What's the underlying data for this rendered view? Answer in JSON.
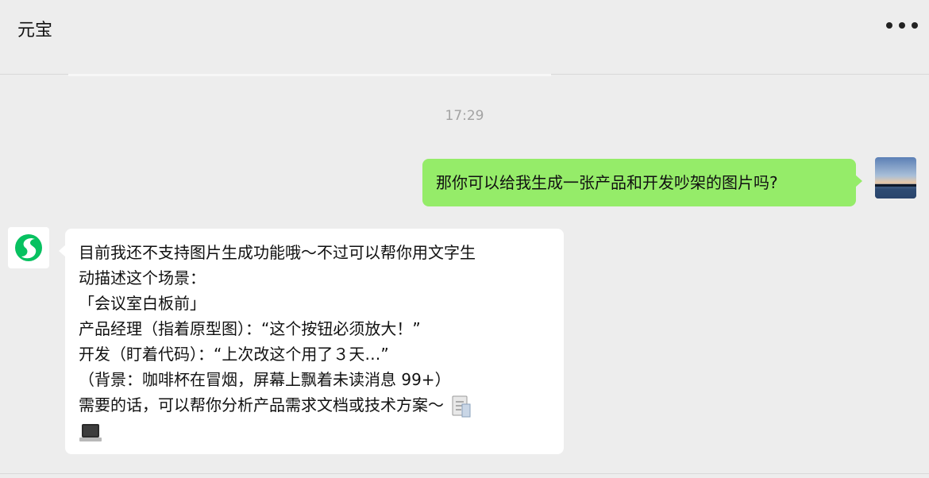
{
  "header": {
    "title": "元宝",
    "more_icon": "more-horizontal-icon"
  },
  "conversation": {
    "timestamp": "17:29",
    "messages": [
      {
        "sender": "user",
        "avatar": "landscape-photo-avatar",
        "text": "那你可以给我生成一张产品和开发吵架的图片吗?"
      },
      {
        "sender": "bot",
        "avatar": "yuanbao-logo-icon",
        "lines": [
          "目前我还不支持图片生成功能哦～不过可以帮你用文字生",
          "动描述这个场景：",
          "「会议室白板前」",
          "产品经理（指着原型图）：“这个按钮必须放大！”",
          "开发（盯着代码）：“上次改这个用了３天…”",
          "（背景：咖啡杯在冒烟，屏幕上飘着未读消息 99+）",
          "需要的话，可以帮你分析产品需求文档或技术方案～"
        ],
        "trailing_icons": [
          "document-icon",
          "laptop-icon"
        ]
      }
    ]
  },
  "colors": {
    "background": "#ededed",
    "user_bubble": "#95ec69",
    "bot_bubble": "#ffffff",
    "timestamp": "#a3a3a3",
    "brand_green": "#07c160"
  }
}
